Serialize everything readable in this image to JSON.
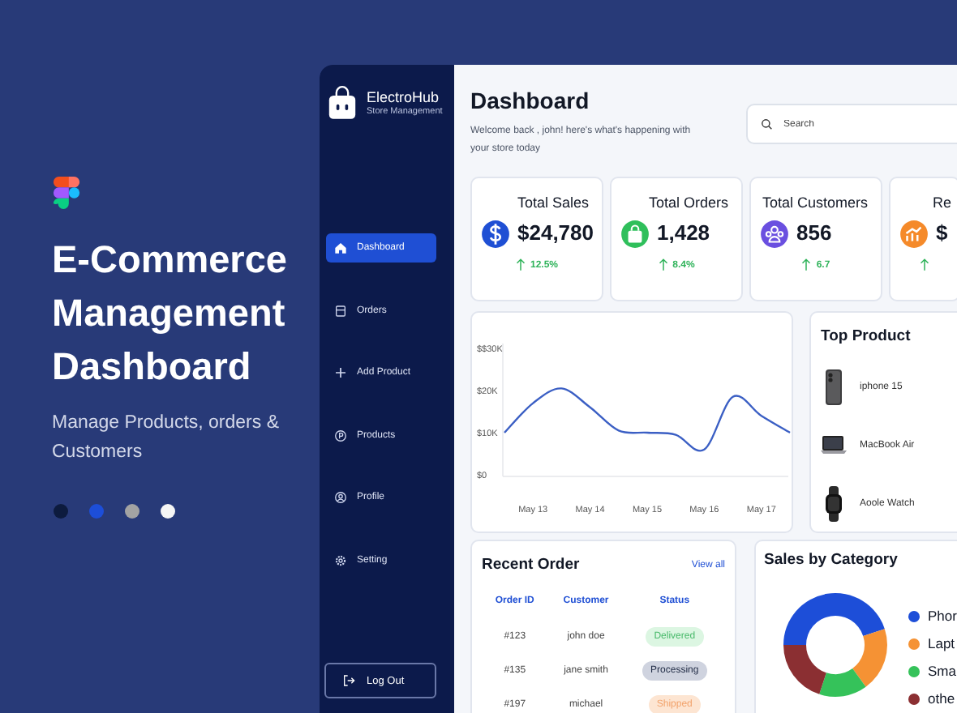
{
  "promo": {
    "title": "E-Commerce Management Dashboard",
    "subtitle": "Manage Products, orders & Customers",
    "palette": [
      {
        "color": "#0d1b3e"
      },
      {
        "color": "#1d4ed8"
      },
      {
        "color": "#a3a3a3"
      },
      {
        "color": "#f5f5f5"
      }
    ]
  },
  "sidebar": {
    "brand": "ElectroHub",
    "tagline": "Store Management",
    "items": [
      {
        "label": "Dashboard",
        "selected": true
      },
      {
        "label": "Orders",
        "selected": false
      },
      {
        "label": "Add Product",
        "selected": false
      },
      {
        "label": "Products",
        "selected": false
      },
      {
        "label": "Profile",
        "selected": false
      },
      {
        "label": "Setting",
        "selected": false
      }
    ],
    "logout": "Log Out"
  },
  "header": {
    "title": "Dashboard",
    "welcome": "Welcome back , john! here's what's happening with your store today",
    "search": {
      "placeholder": "Search"
    }
  },
  "stats": [
    {
      "title": "Total Sales",
      "value": "$24,780",
      "change": "12.5%"
    },
    {
      "title": "Total Orders",
      "value": "1,428",
      "change": "8.4%"
    },
    {
      "title": "Total Customers",
      "value": "856",
      "change": "6.7"
    },
    {
      "title": "Re",
      "value": "$"
    }
  ],
  "sales_chart": {
    "chart_data": {
      "type": "line",
      "categories": [
        null,
        "May 13",
        null,
        "May 14",
        null,
        "May 15",
        null,
        "May 16",
        null,
        "May 17",
        null
      ],
      "series": [
        {
          "color": "#3b5fc4",
          "values": [
            10000,
            17000,
            20500,
            16000,
            10500,
            10000,
            9500,
            6000,
            18500,
            14000,
            10000
          ]
        }
      ],
      "ylim": [
        0,
        30000
      ],
      "yticks": [
        {
          "value": 0,
          "label": "$0"
        },
        {
          "value": 10000,
          "label": "$10K"
        },
        {
          "value": 20000,
          "label": "$20K"
        },
        {
          "value": 30000,
          "label": "$$30K"
        }
      ]
    }
  },
  "top_product": {
    "title": "Top Product",
    "items": [
      {
        "name": "iphone 15",
        "kind": "phone"
      },
      {
        "name": "MacBook Air",
        "kind": "laptop"
      },
      {
        "name": "Aoole Watch",
        "kind": "watch"
      }
    ]
  },
  "recent_order": {
    "title": "Recent Order",
    "link": "View all",
    "columns": [
      "Order ID",
      "Customer",
      "Status"
    ],
    "rows": [
      {
        "id": "#123",
        "customer": "john doe",
        "status": "Delivered",
        "kind": "delivered"
      },
      {
        "id": "#135",
        "customer": "jane smith",
        "status": "Processing",
        "kind": "processing"
      },
      {
        "id": "#197",
        "customer": "michael",
        "status": "Shipped",
        "kind": "shipped"
      }
    ]
  },
  "sales_by_category": {
    "title": "Sales by Category",
    "legend": [
      {
        "label": "Phor",
        "color": "#1d4ed8"
      },
      {
        "label": "Lapt",
        "color": "#f59234"
      },
      {
        "label": "Sma",
        "color": "#35c25a"
      },
      {
        "label": "othe",
        "color": "#8b2f32"
      }
    ]
  }
}
